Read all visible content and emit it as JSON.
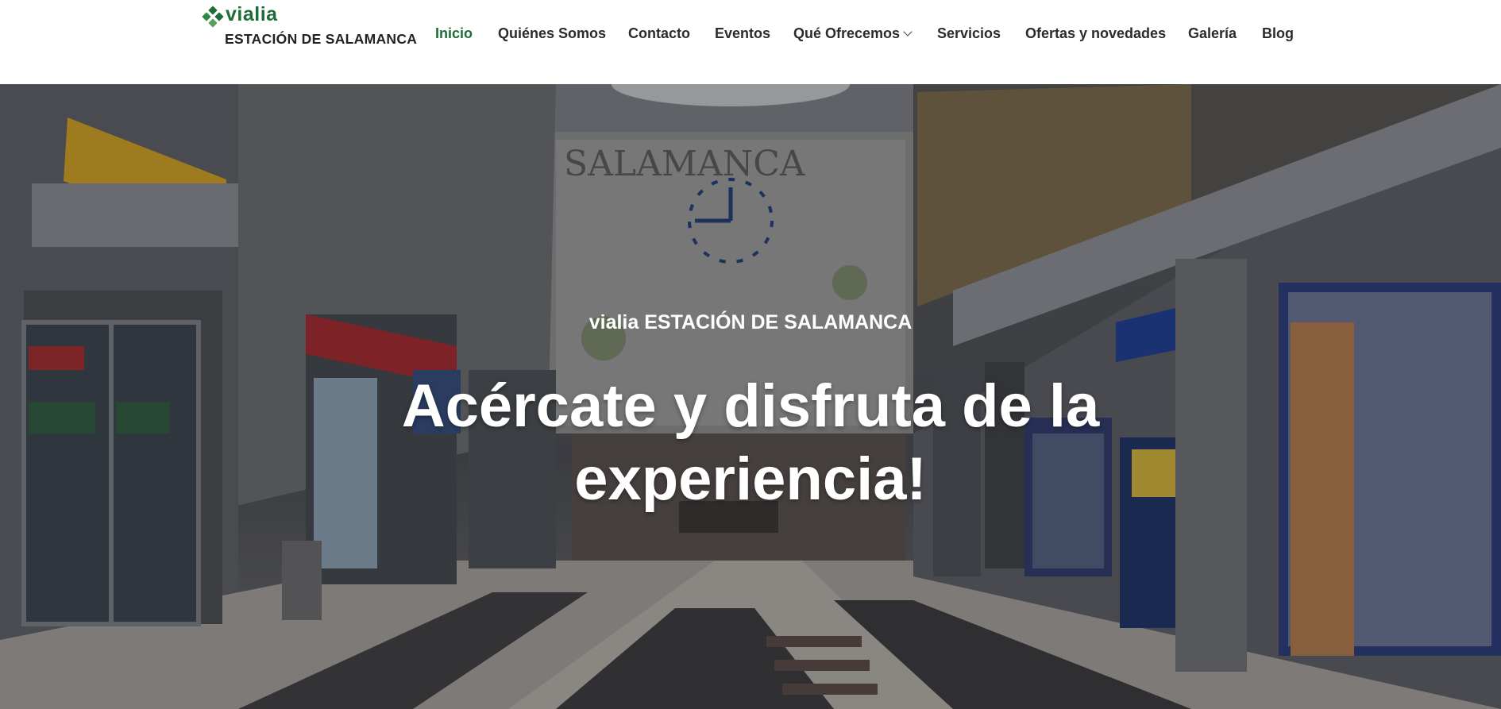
{
  "header": {
    "logo": {
      "brand": "vialia",
      "subtitle": "ESTACIÓN DE SALAMANCA"
    },
    "nav": [
      {
        "label": "Inicio",
        "active": true
      },
      {
        "label": "Quiénes Somos"
      },
      {
        "label": "Contacto"
      },
      {
        "label": "Eventos"
      },
      {
        "label": "Qué Ofrecemos",
        "dropdown": true
      },
      {
        "label": "Servicios"
      },
      {
        "label": "Ofertas y novedades"
      },
      {
        "label": "Galería"
      },
      {
        "label": "Blog"
      }
    ]
  },
  "hero": {
    "kicker": "vialia ESTACIÓN DE SALAMANCA",
    "title_line1": "Acércate y disfruta de la",
    "title_line2": "experiencia!",
    "background_scene": "shopping-mall-interior-photo",
    "colors": {
      "brand_green": "#1e6d36",
      "overlay": "#14161c"
    }
  }
}
